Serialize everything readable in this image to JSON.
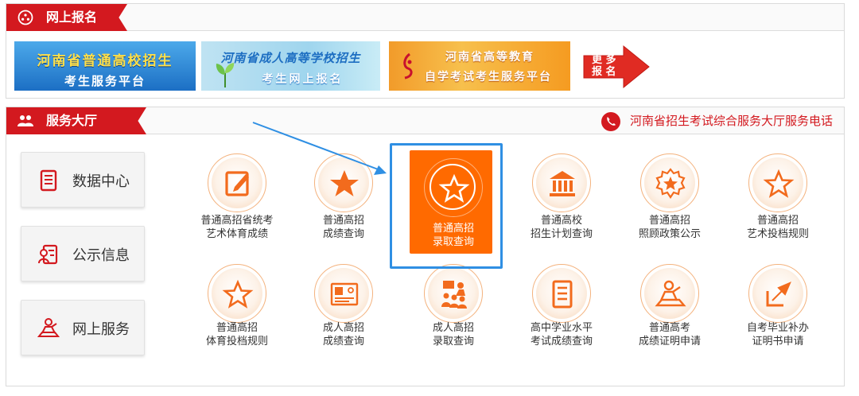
{
  "registration": {
    "title": "网上报名",
    "banners": [
      {
        "line1": "河南省普通高校招生",
        "line2": "考生服务平台"
      },
      {
        "line1": "河南省成人高等学校招生",
        "line2": "考生网上报名"
      },
      {
        "line1": "河南省高等教育",
        "line2": "自学考试考生服务平台"
      }
    ],
    "more_label": "更多报名"
  },
  "service": {
    "title": "服务大厅",
    "hotline": "河南省招生考试综合服务大厅服务电话",
    "side_buttons": [
      {
        "label": "数据中心",
        "icon": "document-list-icon"
      },
      {
        "label": "公示信息",
        "icon": "profile-document-icon"
      },
      {
        "label": "网上服务",
        "icon": "person-desk-icon"
      }
    ],
    "tiles_row1": [
      {
        "line1": "普通高招省统考",
        "line2": "艺术体育成绩",
        "icon": "edit-document-icon"
      },
      {
        "line1": "普通高招",
        "line2": "成绩查询",
        "icon": "filled-star-icon"
      },
      {
        "line1": "普通高招",
        "line2": "录取查询",
        "icon": "star-outline-icon",
        "highlighted": true
      },
      {
        "line1": "普通高校",
        "line2": "招生计划查询",
        "icon": "institution-icon"
      },
      {
        "line1": "普通高招",
        "line2": "照顾政策公示",
        "icon": "badge-star-icon"
      },
      {
        "line1": "普通高招",
        "line2": "艺术投档规则",
        "icon": "star-outline-icon"
      }
    ],
    "tiles_row2": [
      {
        "line1": "普通高招",
        "line2": "体育投档规则",
        "icon": "star-outline-icon"
      },
      {
        "line1": "成人高招",
        "line2": "成绩查询",
        "icon": "certificate-icon"
      },
      {
        "line1": "成人高招",
        "line2": "录取查询",
        "icon": "group-presentation-icon"
      },
      {
        "line1": "高中学业水平",
        "line2": "考试成绩查询",
        "icon": "document-list-icon"
      },
      {
        "line1": "普通高考",
        "line2": "成绩证明申请",
        "icon": "person-desk-icon"
      },
      {
        "line1": "自考毕业补办",
        "line2": "证明书申请",
        "icon": "share-arrow-icon"
      }
    ]
  },
  "colors": {
    "brand_red": "#d3191f",
    "accent_orange": "#ff6a00",
    "highlight_blue": "#2f8fe3"
  }
}
